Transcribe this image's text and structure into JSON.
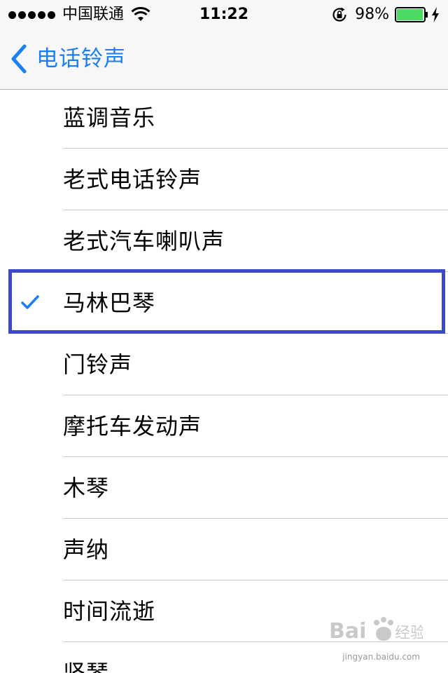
{
  "status_bar": {
    "carrier": "中国联通",
    "time": "11:22",
    "battery_percent": "98%",
    "battery_level": 0.98,
    "icons": [
      "signal-dots",
      "wifi-icon",
      "rotation-lock-icon",
      "battery-icon",
      "charging-bolt-icon"
    ]
  },
  "nav": {
    "back_label": "电话铃声",
    "back_icon": "chevron-left-icon"
  },
  "colors": {
    "accent": "#1a7ff5",
    "highlight_box": "#3c49c6",
    "battery_fill": "#4cd964"
  },
  "ringtones": [
    {
      "label": "蓝调音乐",
      "selected": false
    },
    {
      "label": "老式电话铃声",
      "selected": false
    },
    {
      "label": "老式汽车喇叭声",
      "selected": false
    },
    {
      "label": "马林巴琴",
      "selected": true
    },
    {
      "label": "门铃声",
      "selected": false
    },
    {
      "label": "摩托车发动声",
      "selected": false
    },
    {
      "label": "木琴",
      "selected": false
    },
    {
      "label": "声纳",
      "selected": false
    },
    {
      "label": "时间流逝",
      "selected": false
    },
    {
      "label": "竖琴",
      "selected": false
    }
  ],
  "watermark": {
    "brand": "Baidu经验",
    "url": "jingyan.baidu.com"
  }
}
